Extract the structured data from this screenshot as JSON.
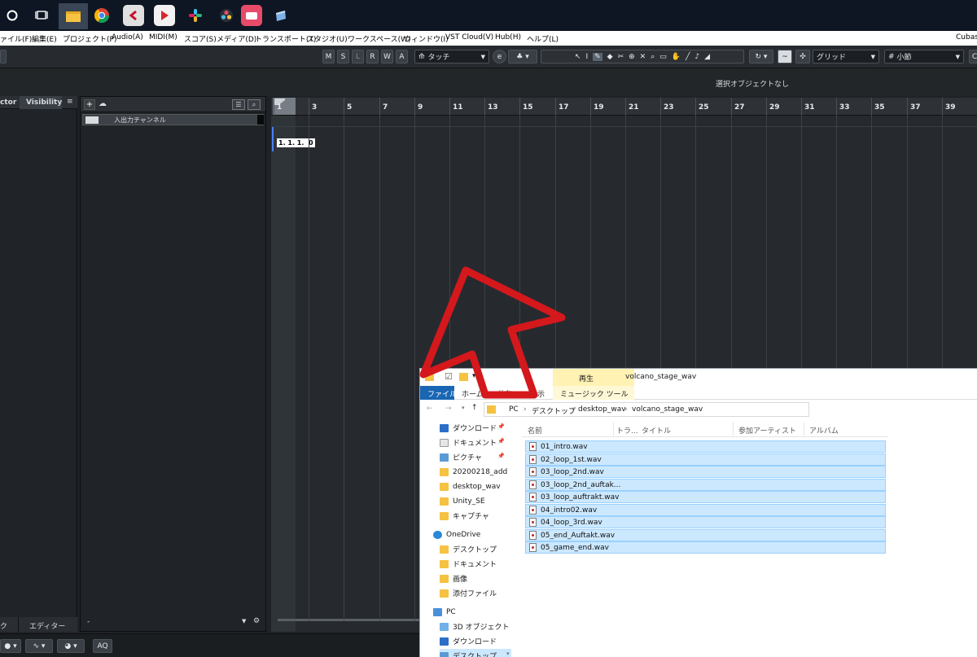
{
  "taskbar": {
    "icons": [
      "search-circle-icon",
      "task-view-icon",
      "file-explorer-icon",
      "chrome-icon",
      "cubase-icon",
      "media-player-icon",
      "slack-icon",
      "davinci-resolve-icon",
      "red-app-icon",
      "notes-app-icon"
    ]
  },
  "menu": {
    "items": [
      "ァイル(F)",
      "編集(E)",
      "プロジェクト(P)",
      "Audio(A)",
      "MIDI(M)",
      "スコア(S)",
      "メディア(D)",
      "トランスポート(T)",
      "スタジオ(U)",
      "ワークスペース(W)",
      "ウィンドウ(I)",
      "VST Cloud(V)",
      "Hub(H)",
      "ヘルプ(L)"
    ],
    "app_name": "Cubas"
  },
  "toolbar": {
    "mode_buttons": [
      "M",
      "S",
      "L",
      "R",
      "W",
      "A"
    ],
    "automation_mode": "タッチ",
    "snap_type": "グリッド",
    "grid_value": "小節",
    "grid_prefix": "#"
  },
  "infobar": {
    "status": "選択オブジェクトなし"
  },
  "inspector": {
    "tab_inspector": "ctor",
    "tab_visibility": "Visibility",
    "bottom_tab_left": "ク",
    "bottom_tab_editor": "エディター"
  },
  "tracklist": {
    "track_name": "入出力チャンネル",
    "footer": "-"
  },
  "ruler": {
    "bars": [
      "1",
      "3",
      "5",
      "7",
      "9",
      "11",
      "13",
      "15",
      "17",
      "19",
      "21",
      "23",
      "25",
      "27",
      "29",
      "31",
      "33",
      "35",
      "37",
      "39"
    ]
  },
  "cursor": {
    "position": "1. 1. 1.  0"
  },
  "statusbar": {
    "aq_label": "AQ"
  },
  "explorer": {
    "ribbon_context": "再生",
    "window_title": "volcano_stage_wav",
    "tabs": [
      "ファイル",
      "ホーム",
      "共有",
      "表示"
    ],
    "music_tools_tab": "ミュージック ツール",
    "breadcrumb": [
      "PC",
      "デスクトップ",
      "desktop_wav",
      "volcano_stage_wav"
    ],
    "columns": [
      "名前",
      "トラ...",
      "タイトル",
      "参加アーティスト",
      "アルバム"
    ],
    "quick_access": [
      "ダウンロード",
      "ドキュメント",
      "ピクチャ",
      "20200218_add",
      "desktop_wav",
      "Unity_SE",
      "キャプチャ"
    ],
    "onedrive": "OneDrive",
    "onedrive_items": [
      "デスクトップ",
      "ドキュメント",
      "画像",
      "添付ファイル"
    ],
    "pc": "PC",
    "pc_items": [
      "3D オブジェクト",
      "ダウンロード",
      "デスクトップ"
    ],
    "files": [
      "01_intro.wav",
      "02_loop_1st.wav",
      "03_loop_2nd.wav",
      "03_loop_2nd_auftak...",
      "03_loop_auftrakt.wav",
      "04_intro02.wav",
      "04_loop_3rd.wav",
      "05_end_Auftakt.wav",
      "05_game_end.wav"
    ]
  },
  "colors": {
    "accent_arrow": "#d4181c",
    "selection": "#cce8ff",
    "taskbar": "#0e1624",
    "cubase_panel": "#202428",
    "explorer_file_tab": "#1966b3"
  }
}
